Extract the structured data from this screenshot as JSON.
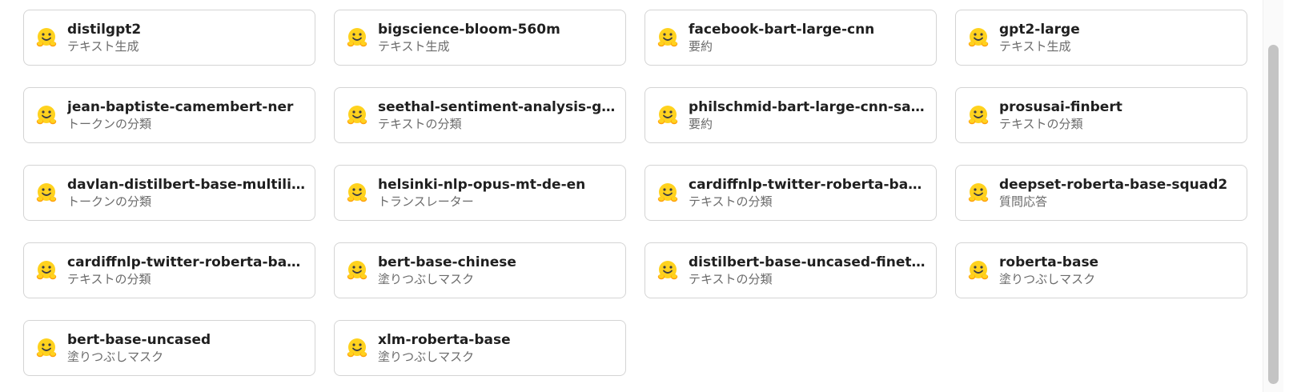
{
  "models": [
    {
      "name": "distilgpt2",
      "task": "テキスト生成"
    },
    {
      "name": "bigscience-bloom-560m",
      "task": "テキスト生成"
    },
    {
      "name": "facebook-bart-large-cnn",
      "task": "要約"
    },
    {
      "name": "gpt2-large",
      "task": "テキスト生成"
    },
    {
      "name": "jean-baptiste-camembert-ner",
      "task": "トークンの分類"
    },
    {
      "name": "seethal-sentiment-analysis-gen…",
      "task": "テキストの分類"
    },
    {
      "name": "philschmid-bart-large-cnn-sam…",
      "task": "要約"
    },
    {
      "name": "prosusai-finbert",
      "task": "テキストの分類"
    },
    {
      "name": "davlan-distilbert-base-multilin…",
      "task": "トークンの分類"
    },
    {
      "name": "helsinki-nlp-opus-mt-de-en",
      "task": "トランスレーター"
    },
    {
      "name": "cardiffnlp-twitter-roberta-base…",
      "task": "テキストの分類"
    },
    {
      "name": "deepset-roberta-base-squad2",
      "task": "質問応答"
    },
    {
      "name": "cardiffnlp-twitter-roberta-base…",
      "task": "テキストの分類"
    },
    {
      "name": "bert-base-chinese",
      "task": "塗りつぶしマスク"
    },
    {
      "name": "distilbert-base-uncased-finetu…",
      "task": "テキストの分類"
    },
    {
      "name": "roberta-base",
      "task": "塗りつぶしマスク"
    },
    {
      "name": "bert-base-uncased",
      "task": "塗りつぶしマスク"
    },
    {
      "name": "xlm-roberta-base",
      "task": "塗りつぶしマスク"
    }
  ],
  "icon": "hugging-face-icon",
  "colors": {
    "icon_face": "#FFD21E",
    "icon_shade": "#FF9D0B",
    "card_border": "#d4d4d4",
    "task_text": "#6b6b6b"
  }
}
